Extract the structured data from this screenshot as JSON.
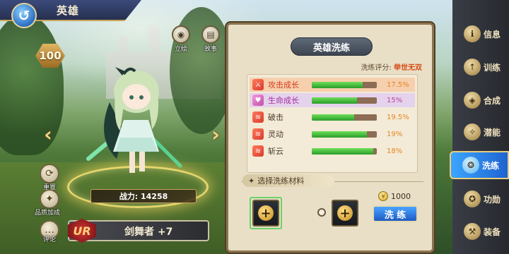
{
  "header": {
    "title": "英雄",
    "back_icon": "back-arrow-icon"
  },
  "hero": {
    "level": "100",
    "power_label": "战力: 14258",
    "rarity": "UR",
    "name": "剑舞者 +7"
  },
  "top_buttons": [
    {
      "label": "立绘",
      "icon": "eye-icon"
    },
    {
      "label": "故事",
      "icon": "book-icon"
    }
  ],
  "side_buttons": [
    {
      "label": "重置",
      "icon": "reset-icon"
    },
    {
      "label": "品质加成",
      "icon": "quality-icon"
    },
    {
      "label": "评论",
      "icon": "chat-icon"
    }
  ],
  "panel": {
    "title": "英雄洗练",
    "score_label": "洗练评分:",
    "score_value": "举世无双",
    "stats": [
      {
        "name": "攻击成长",
        "value": "17.5%",
        "progress": 0.78,
        "highlight": "orange"
      },
      {
        "name": "生命成长",
        "value": "15%",
        "progress": 0.7,
        "highlight": "purple"
      },
      {
        "name": "破击",
        "value": "19.5%",
        "progress": 0.65,
        "highlight": ""
      },
      {
        "name": "灵动",
        "value": "19%",
        "progress": 0.85,
        "highlight": ""
      },
      {
        "name": "斩云",
        "value": "18%",
        "progress": 0.95,
        "highlight": ""
      }
    ],
    "materials_title": "选择洗练材料",
    "cost": "1000",
    "wash_button": "洗 练"
  },
  "menu": [
    {
      "label": "信息",
      "icon": "info-icon",
      "active": false
    },
    {
      "label": "训练",
      "icon": "training-icon",
      "active": false
    },
    {
      "label": "合成",
      "icon": "synthesis-icon",
      "active": false
    },
    {
      "label": "潜能",
      "icon": "potential-icon",
      "active": false
    },
    {
      "label": "洗练",
      "icon": "refine-icon",
      "active": true
    },
    {
      "label": "功勋",
      "icon": "merit-icon",
      "active": false
    },
    {
      "label": "装备",
      "icon": "equipment-icon",
      "active": false
    }
  ],
  "colors": {
    "accent_blue": "#1f63d1",
    "progress_green": "#2a9d2a",
    "score_orange": "#d64a15"
  }
}
